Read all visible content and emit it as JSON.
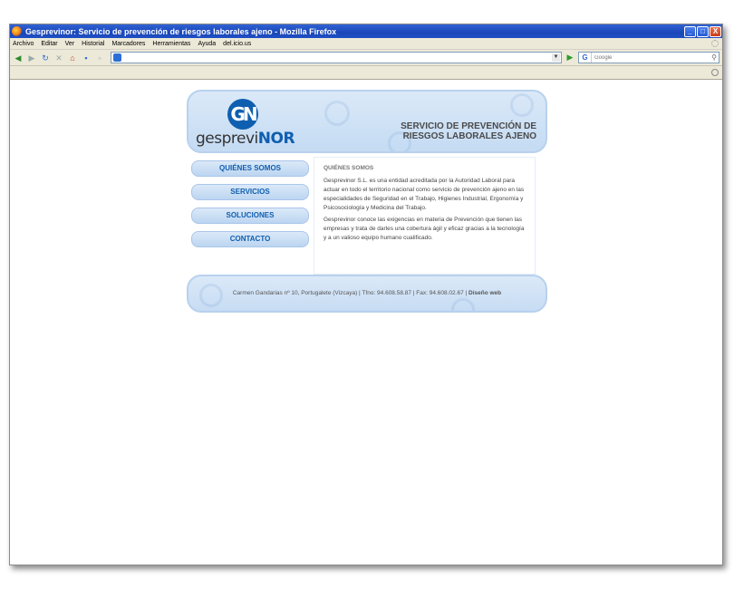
{
  "window": {
    "title": "Gesprevinor: Servicio de prevención de riesgos laborales ajeno - Mozilla Firefox",
    "min_label": "_",
    "max_label": "□",
    "close_label": "X"
  },
  "menubar": {
    "items": [
      "Archivo",
      "Editar",
      "Ver",
      "Historial",
      "Marcadores",
      "Herramientas",
      "Ayuda",
      "del.icio.us"
    ]
  },
  "search": {
    "placeholder": "Google",
    "engine_label": "G"
  },
  "site": {
    "logo_mark": "GN",
    "logo_text_main": "gesprevi",
    "logo_text_accent": "NOR",
    "tagline_line1": "SERVICIO DE PREVENCIÓN DE",
    "tagline_line2": "RIESGOS LABORALES AJENO",
    "nav": [
      "QUIÉNES SOMOS",
      "SERVICIOS",
      "SOLUCIONES",
      "CONTACTO"
    ],
    "section_title": "QUIÉNES SOMOS",
    "paragraph1": "Gesprevinor S.L. es una entidad acreditada por la Autoridad Laboral para actuar en todo el territorio nacional como servicio de prevención ajeno en las especialidades de Seguridad en el Trabajo, Higienes Industrial, Ergonomía y Psicosociología y Medicina del Trabajo.",
    "paragraph2": "Gesprevinor conoce las exigencias en materia de Prevención que tienen las empresas y trata de darles una cobertura ágil y eficaz gracias a la tecnología y a un valioso equipo humano cualificado.",
    "footer_text": "Carmen Gandarias nº 10, Portugalete (Vizcaya) | Tfno: 94.608.58.87 | Fax: 94.608.02.67 |",
    "footer_link": "Diseño web"
  },
  "colors": {
    "brand_blue": "#0f5fb0",
    "header_bg": "#c4dbf3"
  }
}
